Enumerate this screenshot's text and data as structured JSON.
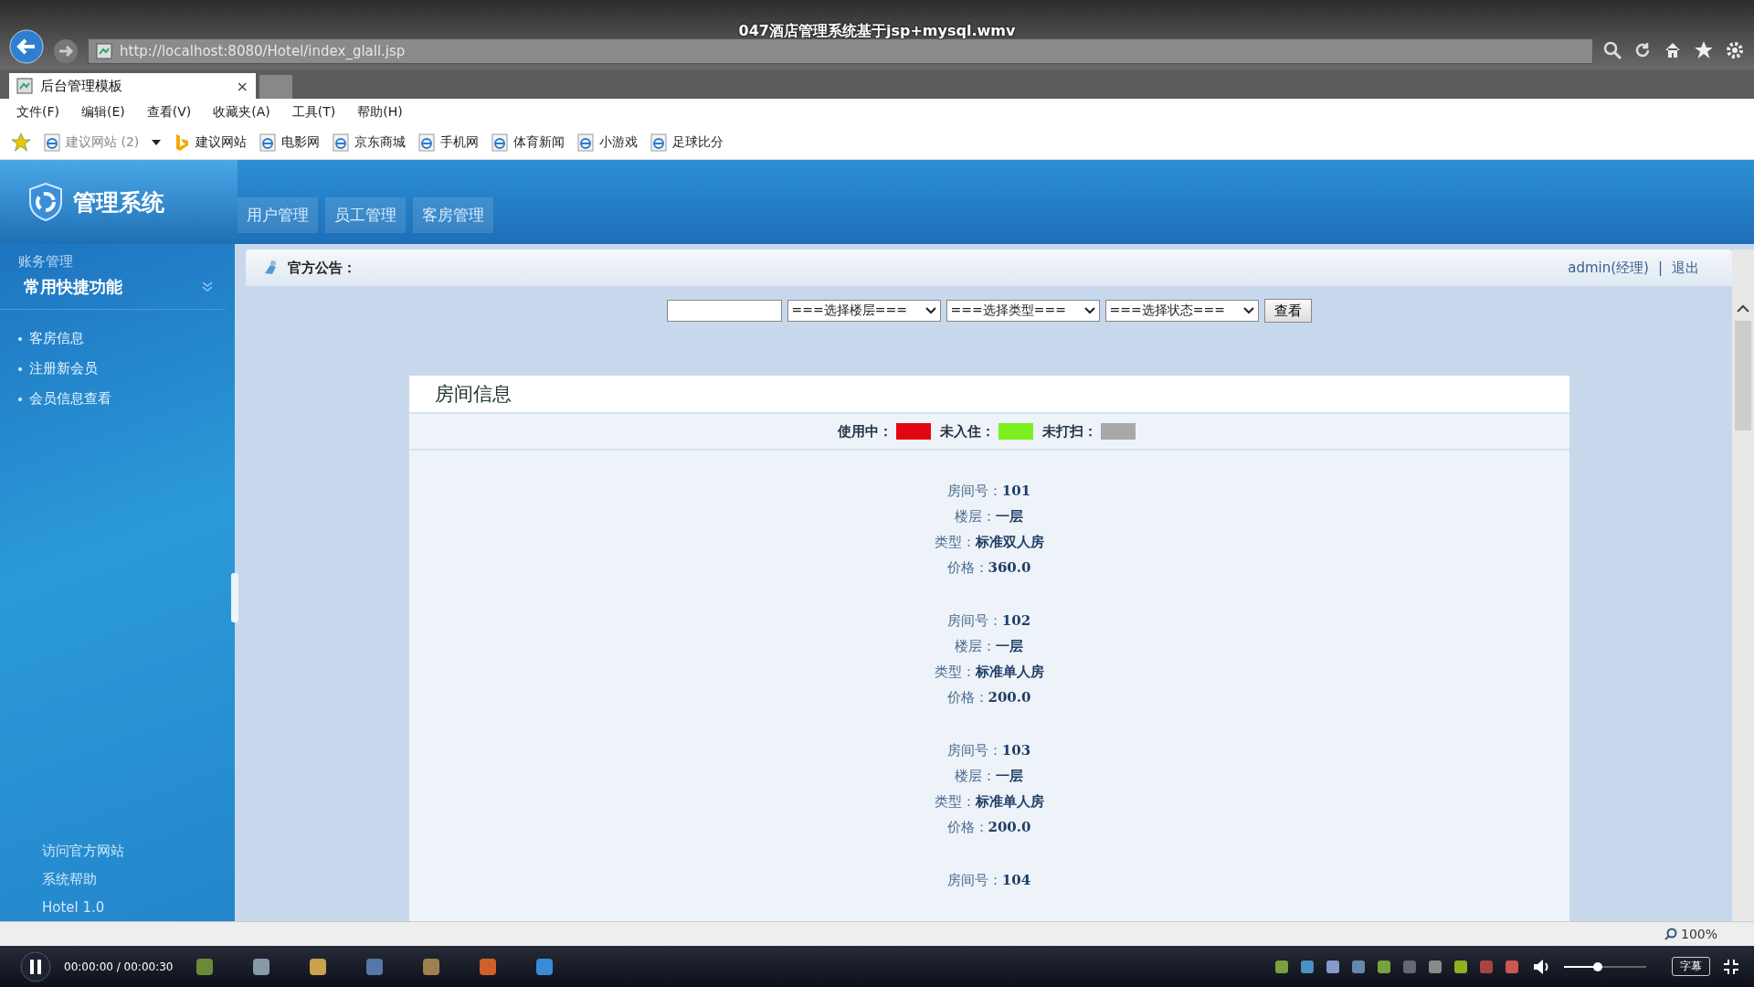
{
  "video": {
    "title": "047酒店管理系统基于jsp+mysql.wmv",
    "time": "00:00:00 / 00:00:30",
    "volume": {
      "level": 0.41
    },
    "subtitle_button": "字幕"
  },
  "browser": {
    "url": "http://localhost:8080/Hotel/index_glall.jsp",
    "tab": {
      "title": "后台管理模板",
      "close": "×"
    },
    "menu": [
      "文件(F)",
      "编辑(E)",
      "查看(V)",
      "收藏夹(A)",
      "工具(T)",
      "帮助(H)"
    ],
    "favorites": [
      {
        "label": "建议网站 (2)",
        "kind": "dropdown"
      },
      {
        "label": "建议网站",
        "kind": "bing"
      },
      {
        "label": "电影网",
        "kind": "page"
      },
      {
        "label": "京东商城",
        "kind": "page"
      },
      {
        "label": "手机网",
        "kind": "page"
      },
      {
        "label": "体育新闻",
        "kind": "page"
      },
      {
        "label": "小游戏",
        "kind": "page"
      },
      {
        "label": "足球比分",
        "kind": "page"
      }
    ],
    "zoom": "100%"
  },
  "app": {
    "logo": "管理系统",
    "nav_tabs": [
      "用户管理",
      "员工管理",
      "客房管理"
    ],
    "sidebar": {
      "section": "账务管理",
      "group": "常用快捷功能",
      "items": [
        "客房信息",
        "注册新会员",
        "会员信息查看"
      ],
      "footer_links": [
        "访问官方网站",
        "系统帮助",
        "Hotel 1.0"
      ]
    },
    "notice": {
      "label": "官方公告：",
      "user": "admin(经理)",
      "separator": "|",
      "logout": "退出"
    },
    "filters": {
      "selects": [
        "===选择楼层===",
        "===选择类型===",
        "===选择状态==="
      ],
      "button": "查看"
    },
    "card": {
      "title": "房间信息",
      "legend": [
        {
          "label": "使用中：",
          "color": "#e30613"
        },
        {
          "label": "未入住：",
          "color": "#7cf01e"
        },
        {
          "label": "未打扫：",
          "color": "#a8a8a8"
        }
      ],
      "rooms": [
        [
          {
            "label": "房间号：",
            "value": "101"
          },
          {
            "label": "楼层：",
            "value": "一层"
          },
          {
            "label": "类型：",
            "value": "标准双人房"
          },
          {
            "label": "价格：",
            "value": "360.0"
          }
        ],
        [
          {
            "label": "房间号：",
            "value": "102"
          },
          {
            "label": "楼层：",
            "value": "一层"
          },
          {
            "label": "类型：",
            "value": "标准单人房"
          },
          {
            "label": "价格：",
            "value": "200.0"
          }
        ],
        [
          {
            "label": "房间号：",
            "value": "103"
          },
          {
            "label": "楼层：",
            "value": "一层"
          },
          {
            "label": "类型：",
            "value": "标准单人房"
          },
          {
            "label": "价格：",
            "value": "200.0"
          }
        ],
        [
          {
            "label": "房间号：",
            "value": "104"
          }
        ]
      ]
    }
  }
}
